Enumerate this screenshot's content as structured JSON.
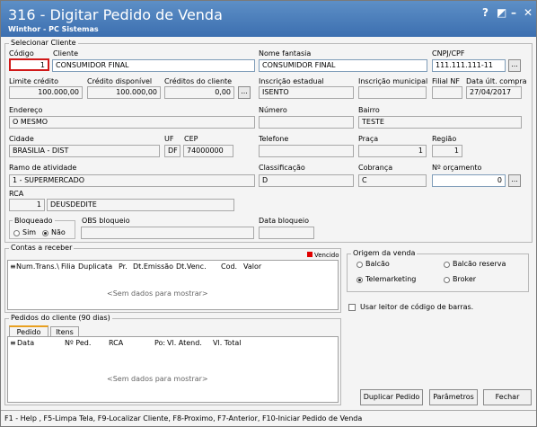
{
  "window": {
    "title": "316 - Digitar Pedido de Venda",
    "subtitle": "Winthor - PC Sistemas",
    "help_glyph": "?",
    "controls": {
      "restore": "◩",
      "minimize": "–",
      "close": "✕"
    }
  },
  "cliente_group": {
    "title": "Selecionar Cliente",
    "codigo_label": "Código",
    "codigo_value": "1",
    "cliente_label": "Cliente",
    "cliente_value": "CONSUMIDOR FINAL",
    "nome_fantasia_label": "Nome fantasia",
    "nome_fantasia_value": "CONSUMIDOR FINAL",
    "cnpj_label": "CNPJ/CPF",
    "cnpj_value": "111.111.111-11",
    "limite_label": "Limite crédito",
    "limite_value": "100.000,00",
    "credito_disp_label": "Crédito disponível",
    "credito_disp_value": "100.000,00",
    "creditos_cliente_label": "Créditos do cliente",
    "creditos_cliente_value": "0,00",
    "insc_estadual_label": "Inscrição estadual",
    "insc_estadual_value": "ISENTO",
    "insc_municipal_label": "Inscrição municipal",
    "insc_municipal_value": "",
    "filial_nf_label": "Filial NF",
    "filial_nf_value": "",
    "data_ult_compra_label": "Data últ. compra",
    "data_ult_compra_value": "27/04/2017",
    "endereco_label": "Endereço",
    "endereco_value": "O MESMO",
    "numero_label": "Número",
    "numero_value": "",
    "bairro_label": "Bairro",
    "bairro_value": "TESTE",
    "cidade_label": "Cidade",
    "cidade_value": "BRASILIA - DIST",
    "uf_label": "UF",
    "uf_value": "DF",
    "cep_label": "CEP",
    "cep_value": "74000000",
    "telefone_label": "Telefone",
    "telefone_value": "",
    "praca_label": "Praça",
    "praca_value": "1",
    "regiao_label": "Região",
    "regiao_value": "1",
    "ramo_label": "Ramo de atividade",
    "ramo_value": "1 - SUPERMERCADO",
    "classificacao_label": "Classificação",
    "classificacao_value": "D",
    "cobranca_label": "Cobrança",
    "cobranca_value": "C",
    "orcamento_label": "Nº orçamento",
    "orcamento_value": "0",
    "rca_label": "RCA",
    "rca_code": "1",
    "rca_name": "DEUSDEDITE",
    "bloqueado_label": "Bloqueado",
    "bloqueado_sim": "Sim",
    "bloqueado_nao": "Não",
    "bloqueado_selected": "Não",
    "obs_bloqueio_label": "OBS bloqueio",
    "obs_bloqueio_value": "",
    "data_bloqueio_label": "Data bloqueio",
    "data_bloqueio_value": "",
    "ellipsis": "..."
  },
  "contas": {
    "title": "Contas a receber",
    "vencido_label": "Vencido",
    "vencido_color": "#e00000",
    "columns": [
      "Num.Trans.\\",
      "Filia",
      "Duplicata",
      "Pr.",
      "Dt.Emissão",
      "Dt.Venc.",
      "Cod.",
      "Valor"
    ],
    "empty_text": "<Sem dados para mostrar>"
  },
  "origem": {
    "title": "Origem da venda",
    "options": [
      "Balcão",
      "Balcão reserva",
      "Telemarketing",
      "Broker"
    ],
    "selected": "Telemarketing"
  },
  "barcode_label": "Usar leitor de código de barras.",
  "pedidos": {
    "title": "Pedidos do cliente (90 dias)",
    "tabs": [
      "Pedido",
      "Itens"
    ],
    "active_tab": "Pedido",
    "columns": [
      "Data",
      "Nº Ped.",
      "RCA",
      "Po:",
      "Vl. Atend.",
      "Vl. Total"
    ],
    "empty_text": "<Sem dados para mostrar>"
  },
  "buttons": {
    "duplicar": "Duplicar Pedido",
    "parametros": "Parâmetros",
    "fechar": "Fechar"
  },
  "status_bar": "F1 - Help , F5-Limpa Tela, F9-Localizar Cliente, F8-Proximo, F7-Anterior, F10-Iniciar Pedido de Venda"
}
